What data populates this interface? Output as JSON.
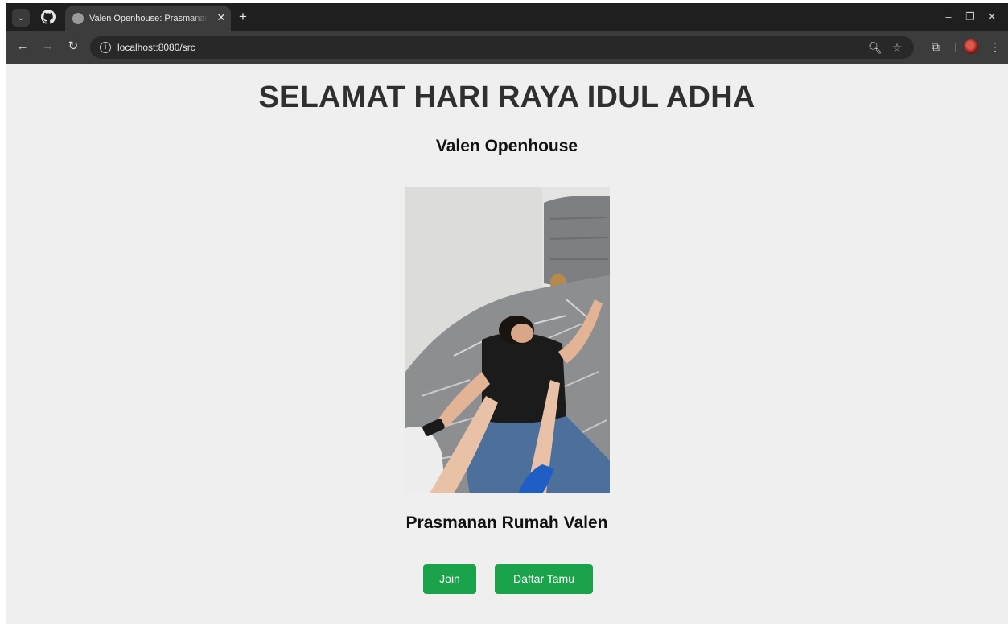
{
  "browser": {
    "tab_title": "Valen Openhouse: Prasmanan di",
    "tab_close": "✕",
    "new_tab": "+",
    "url": "localhost:8080/src",
    "window_controls": {
      "minimize": "–",
      "restore": "❐",
      "close": "✕"
    },
    "nav": {
      "back": "←",
      "forward": "→",
      "reload": "↻"
    },
    "icons": [
      "tab-search-icon",
      "github-icon",
      "globe-icon",
      "info-icon",
      "zoom-icon",
      "star-icon",
      "extensions-icon",
      "profile-avatar",
      "menu-icon"
    ],
    "toolbar_glyphs": {
      "zoom": "🔍︎",
      "star": "☆",
      "extensions": "⧉",
      "menu": "⋮",
      "tab_menu": "⌄",
      "info": "i"
    }
  },
  "page": {
    "title": "SELAMAT HARI RAYA IDUL ADHA",
    "subtitle": "Valen Openhouse",
    "caption": "Prasmanan Rumah Valen",
    "buttons": {
      "join": "Join",
      "guest_list": "Daftar Tamu"
    },
    "colors": {
      "background": "#efefef",
      "button": "#1aa34a",
      "title": "#2f2f2f"
    }
  }
}
